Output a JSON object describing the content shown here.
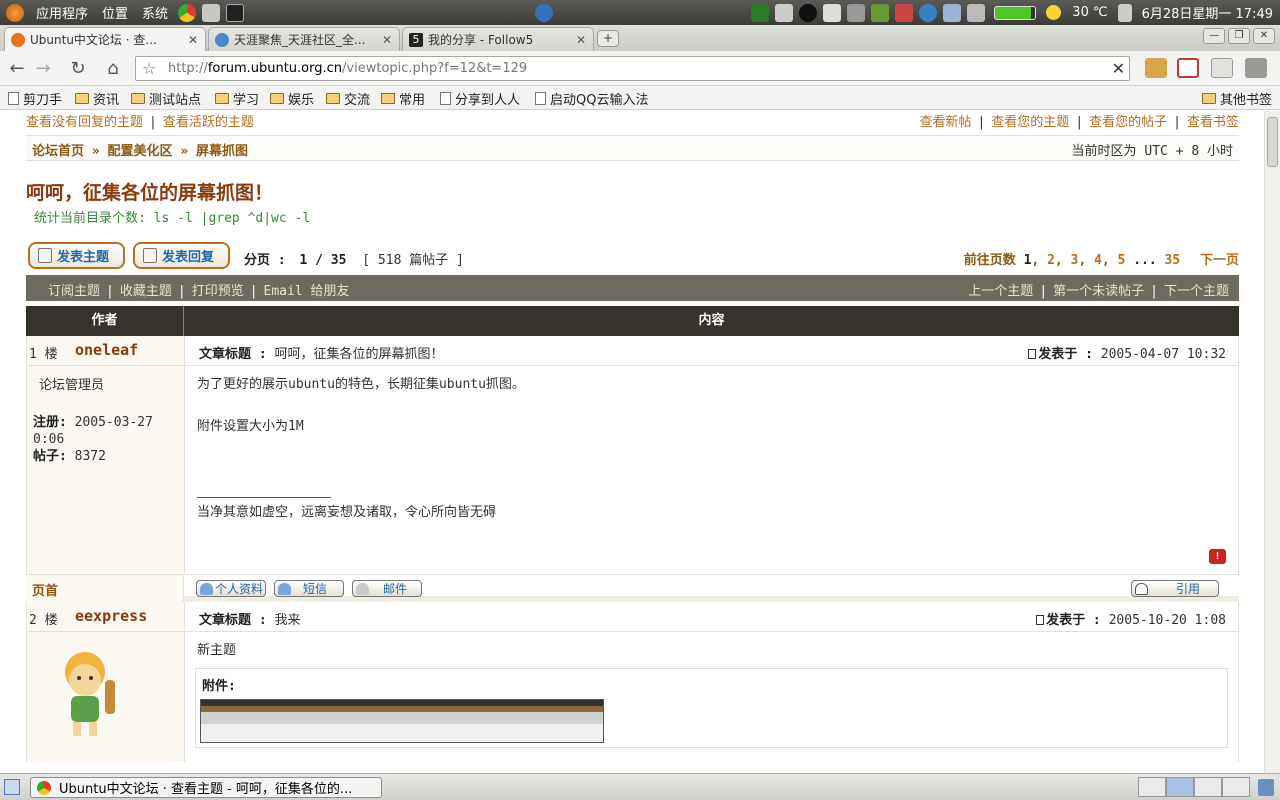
{
  "panel": {
    "menu_apps": "应用程序",
    "menu_places": "位置",
    "menu_system": "系统",
    "weather": "30 ℃",
    "datetime": "6月28日星期一  17:49"
  },
  "tabs": [
    {
      "title": "Ubuntu中文论坛 · 查..."
    },
    {
      "title": "天涯聚焦_天涯社区_全..."
    },
    {
      "title": "我的分享 - Follow5"
    }
  ],
  "url": {
    "scheme": "http://",
    "host": "forum.ubuntu.org.cn",
    "path": "/viewtopic.php?f=12&t=129"
  },
  "bookmarks": [
    "剪刀手",
    "资讯",
    "测试站点",
    "学习",
    "娱乐",
    "交流",
    "常用",
    "分享到人人",
    "启动QQ云输入法",
    "其他书签"
  ],
  "forum": {
    "toplinks_left": [
      "查看没有回复的主题",
      "查看活跃的主题"
    ],
    "toplinks_right": [
      "查看新帖",
      "查看您的主题",
      "查看您的帖子",
      "查看书签"
    ],
    "breadcrumb": [
      "论坛首页",
      "配置美化区",
      "屏幕抓图"
    ],
    "timezone": "当前时区为 UTC + 8 小时",
    "topic_title": "呵呵，征集各位的屏幕抓图！",
    "topic_desc": "统计当前目录个数: ls -l |grep ^d|wc -l",
    "btn_new_topic": "发表主题",
    "btn_reply": "发表回复",
    "page_label": "分页 :",
    "page_value": "1 / 35",
    "post_count": "[ 518 篇帖子 ]",
    "goto_label": "前往页数",
    "pages": [
      "1",
      "2",
      "3",
      "4",
      "5",
      "...",
      "35"
    ],
    "next_page": "下一页",
    "actions_left": [
      "订阅主题",
      "收藏主题",
      "打印预览",
      "Email 给朋友"
    ],
    "actions_right": [
      "上一个主题",
      "第一个未读帖子",
      "下一个主题"
    ],
    "col_author": "作者",
    "col_content": "内容",
    "subject_label": "文章标题 :",
    "posted_label": "发表于 :",
    "top_label": "页首",
    "btn_profile": "个人资料",
    "btn_pm": "短信",
    "btn_email": "邮件",
    "btn_quote": "引用",
    "reg_label": "注册:",
    "posts_label": "帖子:",
    "attach_label": "附件:"
  },
  "posts": [
    {
      "floor": "1 楼",
      "author": "oneleaf",
      "subject": "呵呵，征集各位的屏幕抓图！",
      "date": "2005-04-07 10:32",
      "rank": "论坛管理员",
      "reg_date": "2005-03-27 0:06",
      "post_count": "8372",
      "body1": "为了更好的展示ubuntu的特色，长期征集ubuntu抓图。",
      "body2": "附件设置大小为1M",
      "signature": "当净其意如虚空，远离妄想及诸取，令心所向皆无碍"
    },
    {
      "floor": "2 楼",
      "author": "eexpress",
      "subject": "我来",
      "date": "2005-10-20 1:08",
      "body1": "新主题"
    }
  ],
  "taskbar": {
    "window_title": "Ubuntu中文论坛 · 查看主题 - 呵呵，征集各位的..."
  }
}
